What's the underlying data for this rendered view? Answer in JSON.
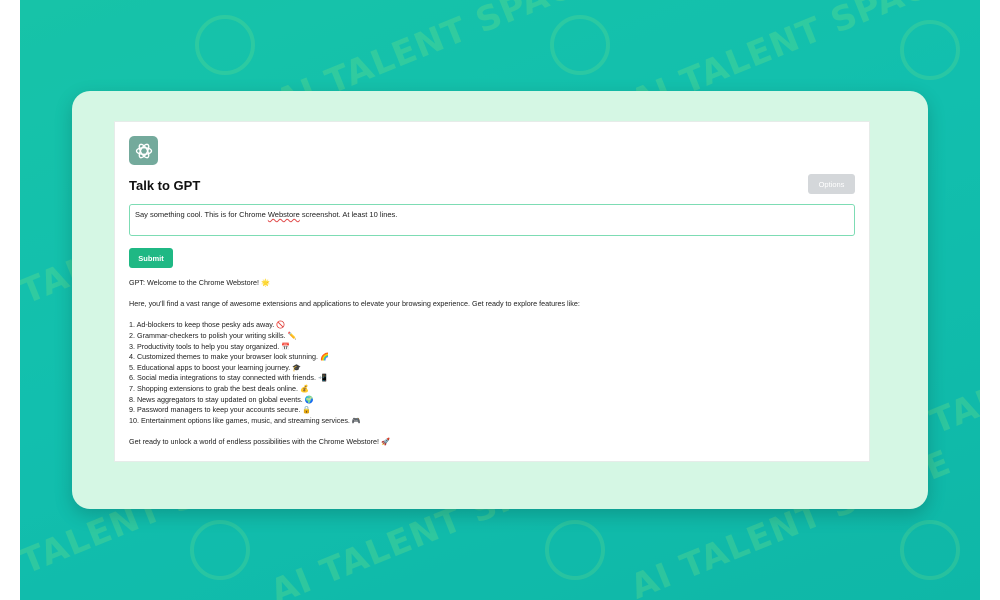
{
  "watermark": "AI TALENT SPACE",
  "colors": {
    "background": "#12bfae",
    "frame": "#d5f7e4",
    "accent": "#1fb884",
    "logo_bg": "#74aa9c",
    "options_btn": "#d4d7da"
  },
  "app": {
    "logo_icon": "openai-logo-icon",
    "title": "Talk to GPT",
    "options_label": "Options",
    "prompt_before": "Say something cool. This is for Chrome ",
    "prompt_misspelled": "Webstore",
    "prompt_after": " screenshot. At least 10 lines.",
    "submit_label": "Submit"
  },
  "response": {
    "intro": "GPT: Welcome to the Chrome Webstore! 🌟",
    "lead": "Here, you'll find a vast range of awesome extensions and applications to elevate your browsing experience. Get ready to explore features like:",
    "items": [
      "1. Ad-blockers to keep those pesky ads away. 🚫",
      "2. Grammar-checkers to polish your writing skills. ✏️",
      "3. Productivity tools to help you stay organized. 📅",
      "4. Customized themes to make your browser look stunning. 🌈",
      "5. Educational apps to boost your learning journey. 🎓",
      "6. Social media integrations to stay connected with friends. 📲",
      "7. Shopping extensions to grab the best deals online. 💰",
      "8. News aggregators to stay updated on global events. 🌍",
      "9. Password managers to keep your accounts secure. 🔒",
      "10. Entertainment options like games, music, and streaming services. 🎮"
    ],
    "closing": "Get ready to unlock a world of endless possibilities with the Chrome Webstore! 🚀"
  }
}
